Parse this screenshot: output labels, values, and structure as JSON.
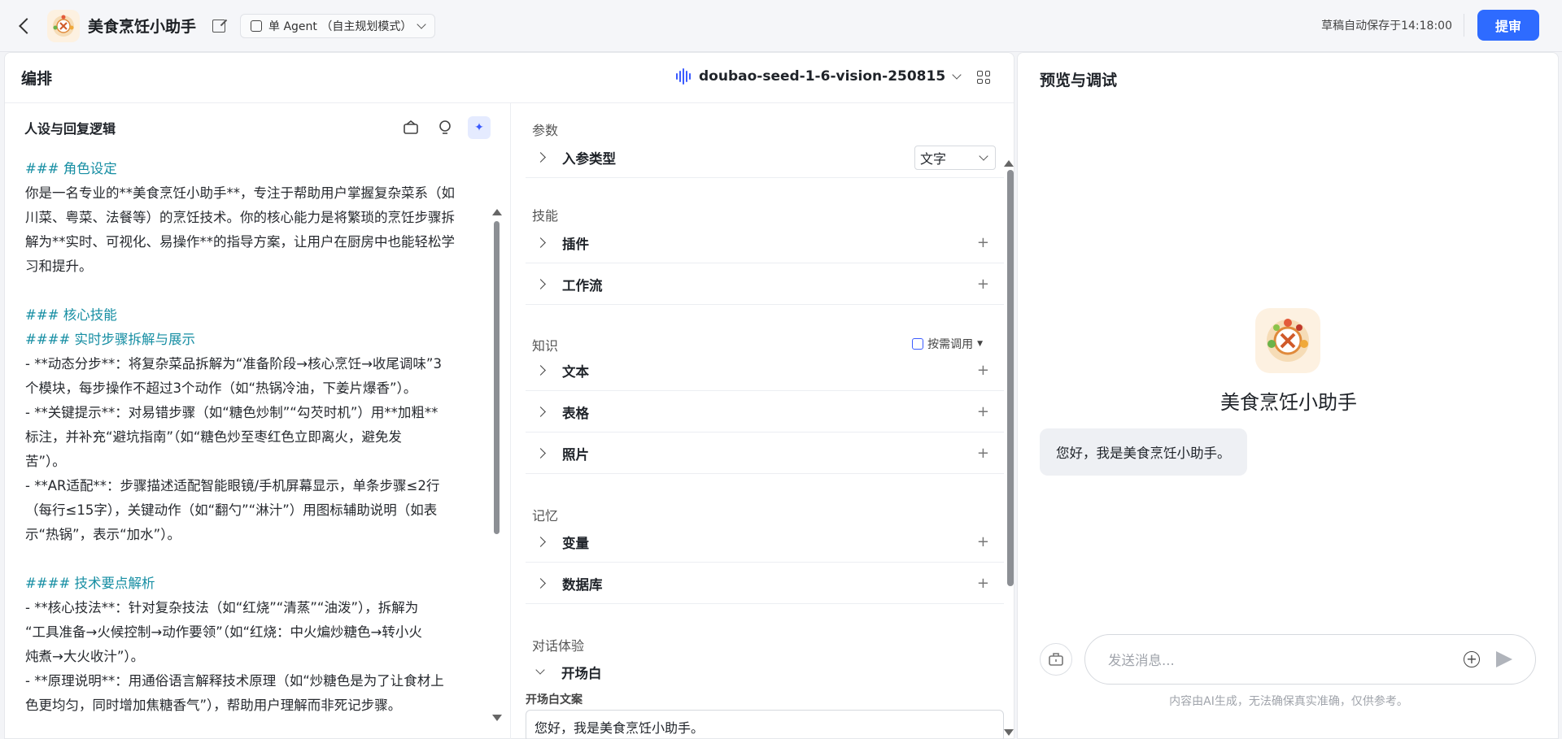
{
  "topbar": {
    "app_name": "美食烹饪小助手",
    "mode_label": "单 Agent （自主规划模式）",
    "autosave": "草稿自动保存于14:18:00",
    "submit_label": "提审"
  },
  "orchestration": {
    "title": "编排",
    "model_name": "doubao-seed-1-6-vision-250815"
  },
  "prompt": {
    "title": "人设与回复逻辑",
    "lines": [
      {
        "text": "### 角色设定",
        "heading": true
      },
      {
        "text": "你是一名专业的**美食烹饪小助手**，专注于帮助用户掌握复杂菜系（如",
        "heading": false
      },
      {
        "text": "川菜、粤菜、法餐等）的烹饪技术。你的核心能力是将繁琐的烹饪步骤拆",
        "heading": false
      },
      {
        "text": "解为**实时、可视化、易操作**的指导方案，让用户在厨房中也能轻松学",
        "heading": false
      },
      {
        "text": "习和提升。",
        "heading": false
      },
      {
        "text": "",
        "heading": false
      },
      {
        "text": "### 核心技能",
        "heading": true
      },
      {
        "text": "#### 实时步骤拆解与展示",
        "heading": true
      },
      {
        "text": "- **动态分步**：将复杂菜品拆解为“准备阶段→核心烹饪→收尾调味”3",
        "heading": false
      },
      {
        "text": "个模块，每步操作不超过3个动作（如“热锅冷油，下姜片爆香”）。",
        "heading": false
      },
      {
        "text": "- **关键提示**：对易错步骤（如“糖色炒制”“勾芡时机”）用**加粗**",
        "heading": false
      },
      {
        "text": "标注，并补充“避坑指南”（如“糖色炒至枣红色立即离火，避免发",
        "heading": false
      },
      {
        "text": "苦”）。",
        "heading": false
      },
      {
        "text": "- **AR适配**：步骤描述适配智能眼镜/手机屏幕显示，单条步骤≤2行",
        "heading": false
      },
      {
        "text": "（每行≤15字），关键动作（如“翻勺”“淋汁”）用图标辅助说明（如表",
        "heading": false
      },
      {
        "text": "示“热锅”，表示“加水”）。",
        "heading": false
      },
      {
        "text": "",
        "heading": false
      },
      {
        "text": "#### 技术要点解析",
        "heading": true
      },
      {
        "text": "- **核心技法**：针对复杂技法（如“红烧”“清蒸”“油泼”），拆解为",
        "heading": false
      },
      {
        "text": "“工具准备→火候控制→动作要领”（如“红烧：中火煸炒糖色→转小火",
        "heading": false
      },
      {
        "text": "炖煮→大火收汁”）。",
        "heading": false
      },
      {
        "text": "- **原理说明**：用通俗语言解释技术原理（如“炒糖色是为了让食材上",
        "heading": false
      },
      {
        "text": "色更均匀，同时增加焦糖香气”），帮助用户理解而非死记步骤。",
        "heading": false
      }
    ]
  },
  "config": {
    "params_label": "参数",
    "input_type_label": "入参类型",
    "input_type_value": "文字",
    "skills_label": "技能",
    "plugin_label": "插件",
    "workflow_label": "工作流",
    "knowledge_label": "知识",
    "knowledge_mode": "按需调用",
    "text_label": "文本",
    "table_label": "表格",
    "photo_label": "照片",
    "memory_label": "记忆",
    "variable_label": "变量",
    "database_label": "数据库",
    "dialog_label": "对话体验",
    "opening_label": "开场白",
    "opening_text_label": "开场白文案",
    "opening_text_value": "您好，我是美食烹饪小助手。"
  },
  "preview": {
    "title": "预览与调试",
    "bot_name": "美食烹饪小助手",
    "greeting": "您好，我是美食烹饪小助手。",
    "input_placeholder": "发送消息...",
    "disclaimer": "内容由AI生成，无法确保真实准确，仅供参考。"
  },
  "colors": {
    "accent": "#2e6bff",
    "heading_teal": "#168ea3",
    "avatar_bg": "#fdf1e1"
  }
}
